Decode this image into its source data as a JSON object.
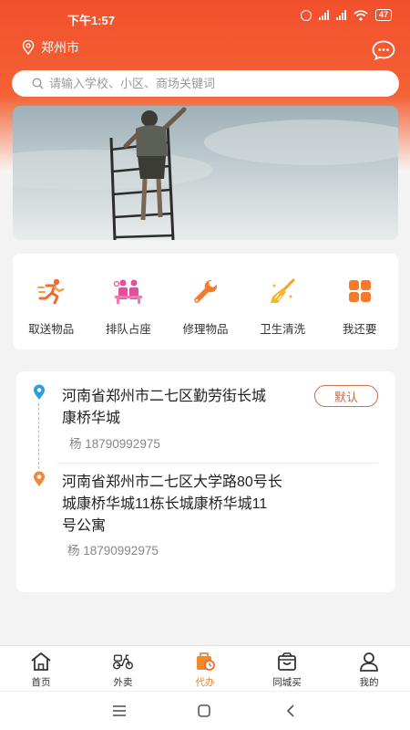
{
  "status": {
    "time": "下午1:57",
    "battery": "47"
  },
  "location": {
    "city": "郑州市"
  },
  "search": {
    "placeholder": "请输入学校、小区、商场关键词"
  },
  "services": [
    {
      "label": "取送物品",
      "icon": "running-man-icon"
    },
    {
      "label": "排队占座",
      "icon": "queue-people-icon"
    },
    {
      "label": "修理物品",
      "icon": "wrench-icon"
    },
    {
      "label": "卫生清洗",
      "icon": "broom-icon"
    },
    {
      "label": "我还要",
      "icon": "grid-more-icon"
    }
  ],
  "addresses": {
    "pickup": {
      "line1": "河南省郑州市二七区勤劳街长城",
      "line2": "康桥华城",
      "contact": "杨 18790992975",
      "default_label": "默认"
    },
    "delivery": {
      "line1": "河南省郑州市二七区大学路80号长",
      "line2": "城康桥华城11栋长城康桥华城11",
      "line3": "号公寓",
      "contact": "杨 18790992975"
    }
  },
  "tabs": [
    {
      "label": "首页",
      "icon": "home-icon"
    },
    {
      "label": "外卖",
      "icon": "scooter-icon"
    },
    {
      "label": "代办",
      "icon": "errand-icon"
    },
    {
      "label": "同城买",
      "icon": "shopping-bag-icon"
    },
    {
      "label": "我的",
      "icon": "user-icon"
    }
  ],
  "colors": {
    "brand": "#f2502c",
    "active_tab": "#f07a2a",
    "pin_pickup": "#2a9de0",
    "pin_delivery": "#f0873a"
  }
}
